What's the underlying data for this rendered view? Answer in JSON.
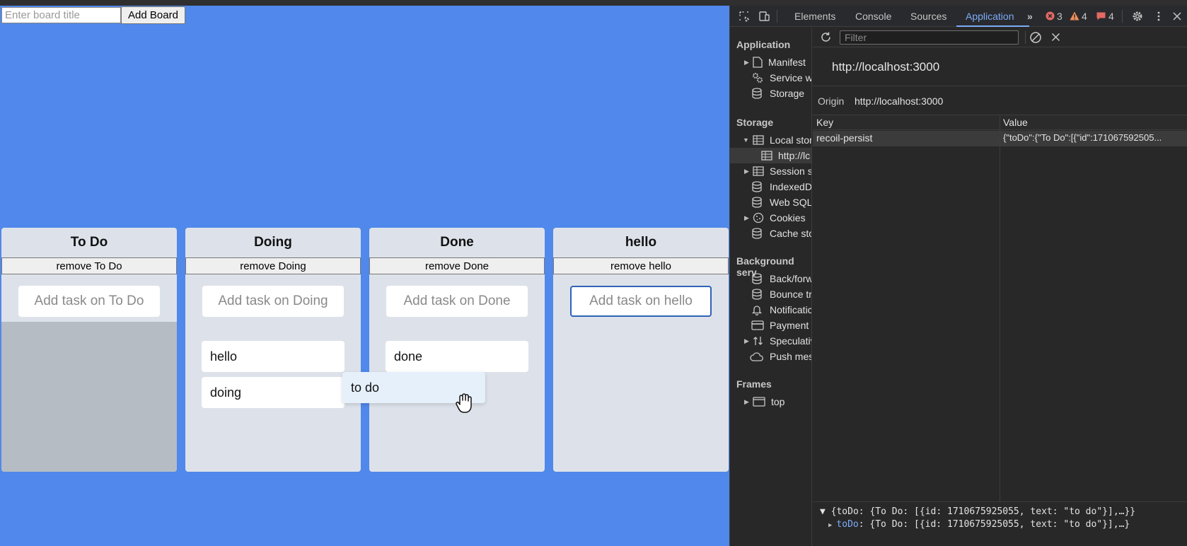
{
  "app": {
    "board_title_placeholder": "Enter board title",
    "add_board_label": "Add Board",
    "boards": [
      {
        "title": "To Do",
        "remove_label": "remove To Do",
        "task_placeholder": "Add task on To Do",
        "cards": []
      },
      {
        "title": "Doing",
        "remove_label": "remove Doing",
        "task_placeholder": "Add task on Doing",
        "cards": [
          "hello",
          "doing"
        ]
      },
      {
        "title": "Done",
        "remove_label": "remove Done",
        "task_placeholder": "Add task on Done",
        "cards": [
          "done"
        ]
      },
      {
        "title": "hello",
        "remove_label": "remove hello",
        "task_placeholder": "Add task on hello",
        "cards": []
      }
    ],
    "dragging_card": "to do"
  },
  "devtools": {
    "tabs": [
      "Elements",
      "Console",
      "Sources",
      "Application"
    ],
    "active_tab": "Application",
    "counts": {
      "errors": "3",
      "warnings": "4",
      "issues": "4"
    },
    "sidebar": {
      "application_header": "Application",
      "application_items": [
        "Manifest",
        "Service w",
        "Storage"
      ],
      "storage_header": "Storage",
      "storage_items": [
        "Local stor",
        "http://lc",
        "Session s",
        "IndexedD",
        "Web SQL",
        "Cookies",
        "Cache sto"
      ],
      "background_header": "Background serv",
      "background_items": [
        "Back/forw",
        "Bounce tr",
        "Notificatic",
        "Payment I",
        "Speculativ",
        "Push mes"
      ],
      "frames_header": "Frames",
      "frames_items": [
        "top"
      ]
    },
    "filter_placeholder": "Filter",
    "origin_heading": "http://localhost:3000",
    "origin_label": "Origin",
    "origin_value": "http://localhost:3000",
    "table": {
      "columns": [
        "Key",
        "Value"
      ],
      "rows": [
        {
          "key": "recoil-persist",
          "value": "{\"toDo\":{\"To Do\":[{\"id\":171067592505..."
        }
      ]
    },
    "preview": {
      "line1": "▼ {toDo: {To Do: [{id: 1710675925055, text: \"to do\"}],…}}",
      "line2_key": "toDo",
      "line2_rest": ": {To Do: [{id: 1710675925055, text: \"to do\"}],…}"
    }
  },
  "colors": {
    "app_bg": "#5088eb",
    "board_bg": "#dde2ea",
    "devtools_bg": "#282828",
    "accent": "#7cacf8"
  }
}
